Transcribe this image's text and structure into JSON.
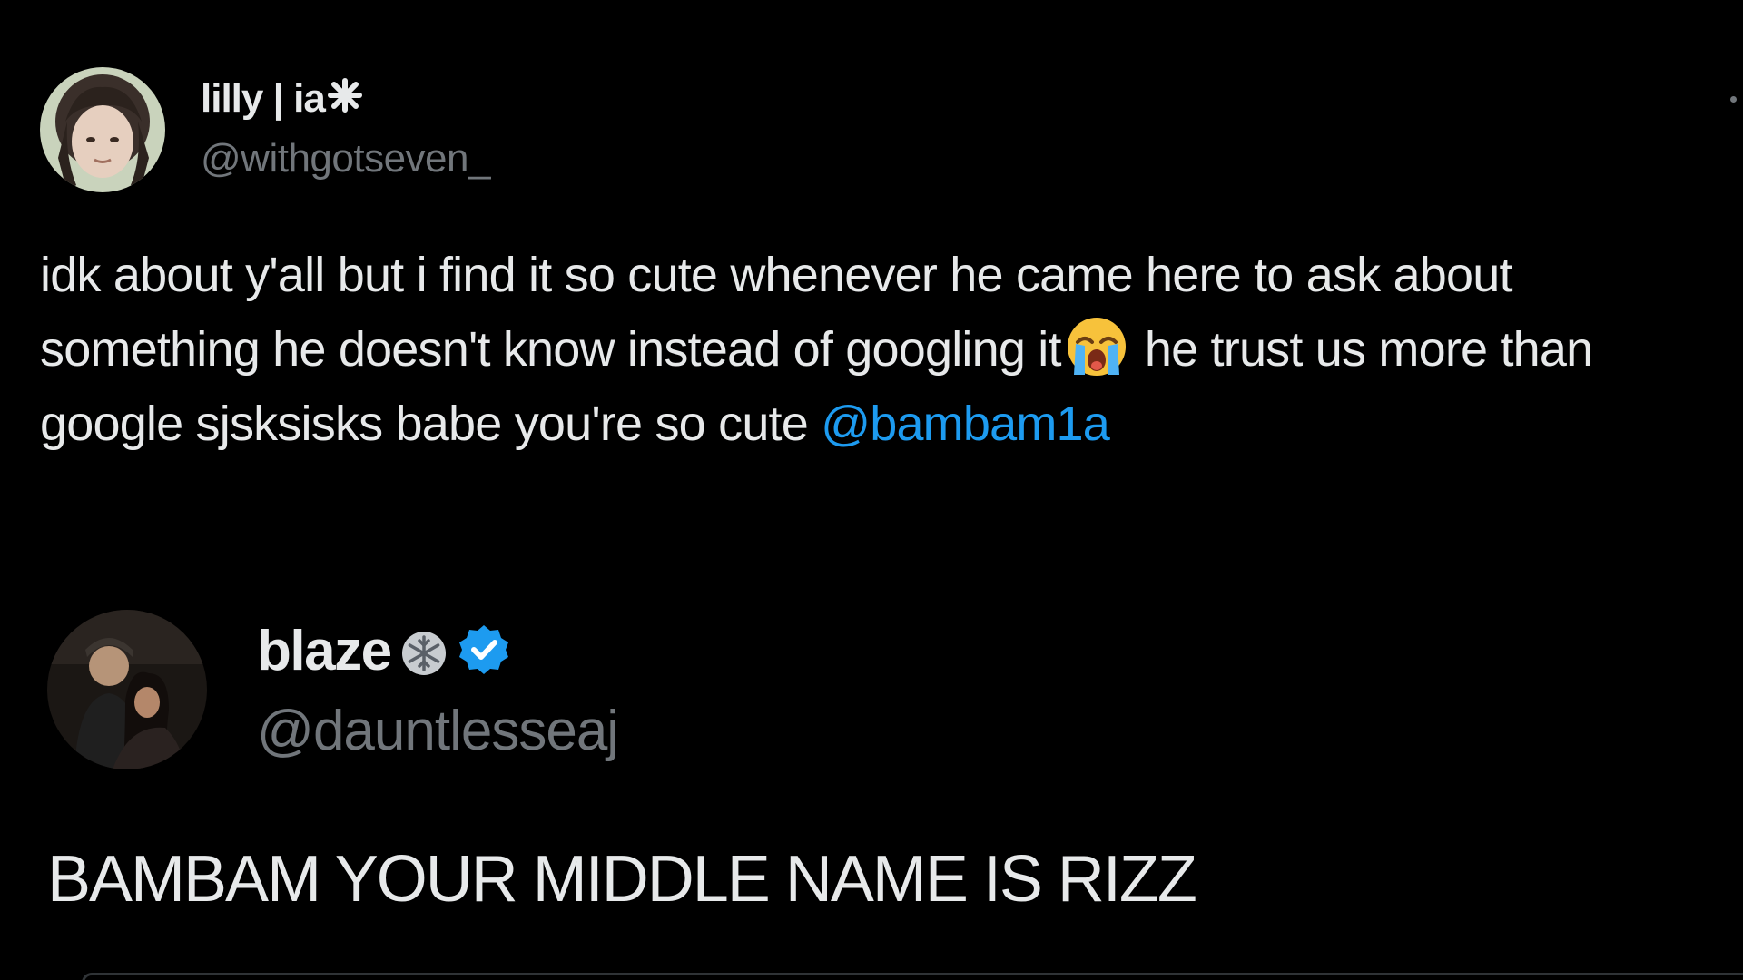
{
  "tweet1": {
    "author_name": "lilly | ia",
    "author_handle": "@withgotseven_",
    "text_before_emoji": "idk about y'all but i find it so cute whenever he came here to ask about something he doesn't know instead of googling it",
    "emoji": "loudly-crying-face",
    "text_after_emoji": " he trust us more than google sjsksisks babe you're so cute ",
    "mention": "@bambam1a",
    "name_icon": "asterisk-star-icon"
  },
  "tweet2": {
    "author_name": "blaze",
    "author_handle": "@dauntlesseaj",
    "text": "BAMBAM YOUR MIDDLE NAME IS RIZZ",
    "name_icons": [
      "snowflake-icon",
      "verified-badge-icon"
    ]
  },
  "colors": {
    "background": "#000000",
    "primary_text": "#e7e9ea",
    "secondary_text": "#71767b",
    "mention": "#1d9bf0",
    "verified": "#1d9bf0"
  }
}
